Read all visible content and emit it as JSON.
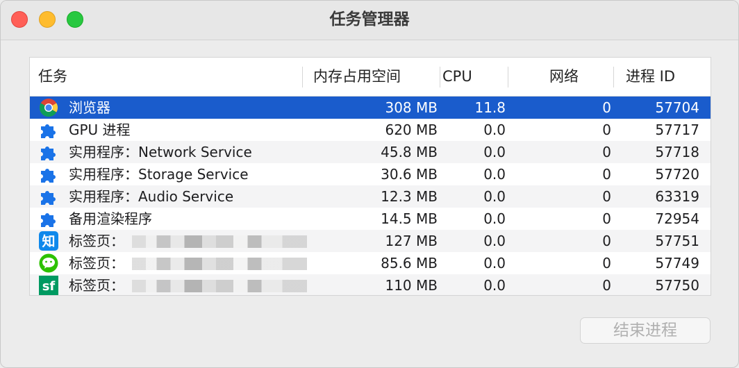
{
  "window": {
    "title": "任务管理器"
  },
  "columns": {
    "task": "任务",
    "memory": "内存占用空间",
    "cpu": "CPU",
    "network": "网络",
    "pid": "进程 ID"
  },
  "rows": [
    {
      "icon": "chrome-icon",
      "name": "浏览器",
      "memory": "308 MB",
      "cpu": "11.8",
      "network": "0",
      "pid": "57704",
      "selected": true
    },
    {
      "icon": "puzzle-icon",
      "name": "GPU 进程",
      "memory": "620 MB",
      "cpu": "0.0",
      "network": "0",
      "pid": "57717"
    },
    {
      "icon": "puzzle-icon",
      "name": "实用程序：Network Service",
      "memory": "45.8 MB",
      "cpu": "0.0",
      "network": "0",
      "pid": "57718"
    },
    {
      "icon": "puzzle-icon",
      "name": "实用程序：Storage Service",
      "memory": "30.6 MB",
      "cpu": "0.0",
      "network": "0",
      "pid": "57720"
    },
    {
      "icon": "puzzle-icon",
      "name": "实用程序：Audio Service",
      "memory": "12.3 MB",
      "cpu": "0.0",
      "network": "0",
      "pid": "63319"
    },
    {
      "icon": "puzzle-icon",
      "name": "备用渲染程序",
      "memory": "14.5 MB",
      "cpu": "0.0",
      "network": "0",
      "pid": "72954"
    },
    {
      "icon": "zhihu-icon",
      "icon_text": "知",
      "name": "标签页：",
      "memory": "127 MB",
      "cpu": "0.0",
      "network": "0",
      "pid": "57751"
    },
    {
      "icon": "wechat-icon",
      "name": "标签页：",
      "memory": "85.6 MB",
      "cpu": "0.0",
      "network": "0",
      "pid": "57749"
    },
    {
      "icon": "segmentfault-icon",
      "icon_text": "sf",
      "name": "标签页：",
      "memory": "110 MB",
      "cpu": "0.0",
      "network": "0",
      "pid": "57750"
    }
  ],
  "end_process_label": "结束进程",
  "colors": {
    "selection": "#1a5ccc",
    "puzzle": "#1a73e8",
    "wechat": "#2dc100",
    "segmentfault": "#009a61",
    "zhihu": "#0f88eb"
  }
}
